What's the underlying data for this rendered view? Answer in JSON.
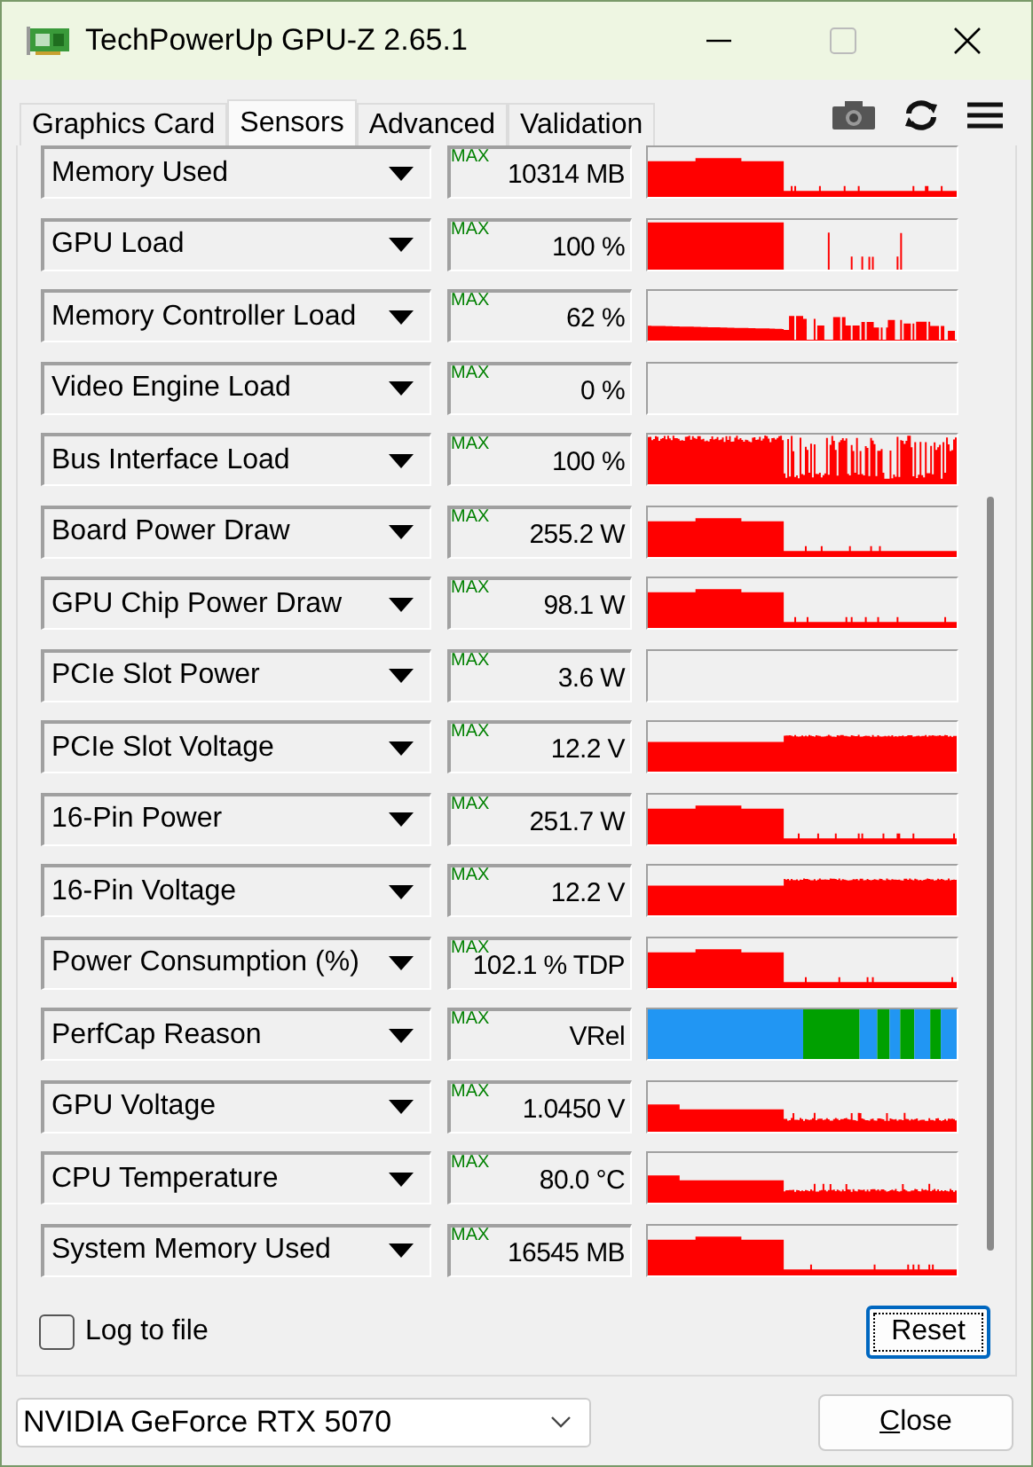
{
  "window": {
    "title": "TechPowerUp GPU-Z 2.65.1"
  },
  "tabs": [
    {
      "label": "Graphics Card",
      "selected": false
    },
    {
      "label": "Sensors",
      "selected": true
    },
    {
      "label": "Advanced",
      "selected": false
    },
    {
      "label": "Validation",
      "selected": false
    }
  ],
  "sensors": [
    {
      "name": "Memory Used",
      "badge": "MAX",
      "value": "10314 MB",
      "kind": "step"
    },
    {
      "name": "GPU Load",
      "badge": "MAX",
      "value": "100 %",
      "kind": "burst"
    },
    {
      "name": "Memory Controller Load",
      "badge": "MAX",
      "value": "62 %",
      "kind": "ragged"
    },
    {
      "name": "Video Engine Load",
      "badge": "MAX",
      "value": "0 %",
      "kind": "empty"
    },
    {
      "name": "Bus Interface Load",
      "badge": "MAX",
      "value": "100 %",
      "kind": "dense"
    },
    {
      "name": "Board Power Draw",
      "badge": "MAX",
      "value": "255.2 W",
      "kind": "step"
    },
    {
      "name": "GPU Chip Power Draw",
      "badge": "MAX",
      "value": "98.1 W",
      "kind": "step"
    },
    {
      "name": "PCIe Slot Power",
      "badge": "MAX",
      "value": "3.6 W",
      "kind": "empty"
    },
    {
      "name": "PCIe Slot Voltage",
      "badge": "MAX",
      "value": "12.2 V",
      "kind": "plateau"
    },
    {
      "name": "16-Pin Power",
      "badge": "MAX",
      "value": "251.7 W",
      "kind": "step"
    },
    {
      "name": "16-Pin Voltage",
      "badge": "MAX",
      "value": "12.2 V",
      "kind": "plateau"
    },
    {
      "name": "Power Consumption (%)",
      "badge": "MAX",
      "value": "102.1 % TDP",
      "kind": "step"
    },
    {
      "name": "PerfCap Reason",
      "badge": "MAX",
      "value": "VRel",
      "kind": "bands"
    },
    {
      "name": "GPU Voltage",
      "badge": "MAX",
      "value": "1.0450 V",
      "kind": "decline"
    },
    {
      "name": "CPU Temperature",
      "badge": "MAX",
      "value": "80.0 °C",
      "kind": "decline"
    },
    {
      "name": "System Memory Used",
      "badge": "MAX",
      "value": "16545 MB",
      "kind": "step"
    }
  ],
  "log_to_file": {
    "label": "Log to file",
    "checked": false
  },
  "reset_button": "Reset",
  "gpu_select": {
    "value": "NVIDIA GeForce RTX 5070"
  },
  "close_button": "Close"
}
